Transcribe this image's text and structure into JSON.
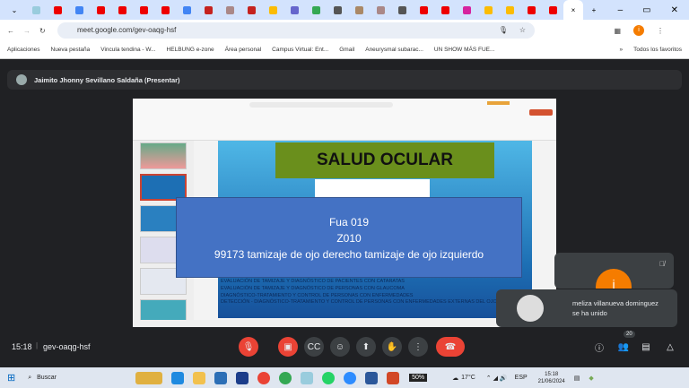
{
  "browser": {
    "url": "meet.google.com/gev-oaqg-hsf",
    "bookmarks": [
      "Aplicaciones",
      "Nueva pestaña",
      "Vincula tendina - W...",
      "HELBUNG e-zone",
      "Área personal",
      "Campus Virtual: Ent...",
      "Gmail",
      "Aneurysmal subarac...",
      "UN SHOW MÁS FUE..."
    ],
    "all_bookmarks": "Todos los favoritos",
    "more": "»",
    "profile_initial": "i"
  },
  "meet": {
    "presenter": "Jaimito Jhonny Sevillano Saldaña (Presentar)",
    "time": "15:18",
    "meeting_code": "gev-oaqg-hsf",
    "participants_count": "20",
    "toast": "meliza villanueva dominguez se ha unido",
    "tile_initial": "i"
  },
  "slide": {
    "title": "SALUD OCULAR",
    "lines": [
      "EVALUACIÓN DE TAMIZAJE Y DIAGNÓSTICO DE PACIENTES CON CATARATAS",
      "EVALUACIÓN DE TAMIZAJE Y DIAGNÓSTICO DE PERSONAS CON GLAUCOMA",
      "DIAGNÓSTICO-TRATAMIENTO Y CONTROL DE PERSONAS CON ENFERMEDADES",
      "DETECCIÓN - DIAGNÓSTICO-TRATAMIENTO Y CONTROL DE PERSONAS CON ENFERMEDADES EXTERNAS DEL OJO"
    ]
  },
  "overlay": {
    "line1": "Fua 019",
    "line2": "Z010",
    "line3": "99173 tamizaje de ojo derecho tamizaje de ojo izquierdo"
  },
  "taskbar": {
    "search": "Buscar",
    "battery": "50%",
    "temp": "17°C",
    "lang": "ESP",
    "time": "15:18",
    "date": "21/06/2024"
  }
}
